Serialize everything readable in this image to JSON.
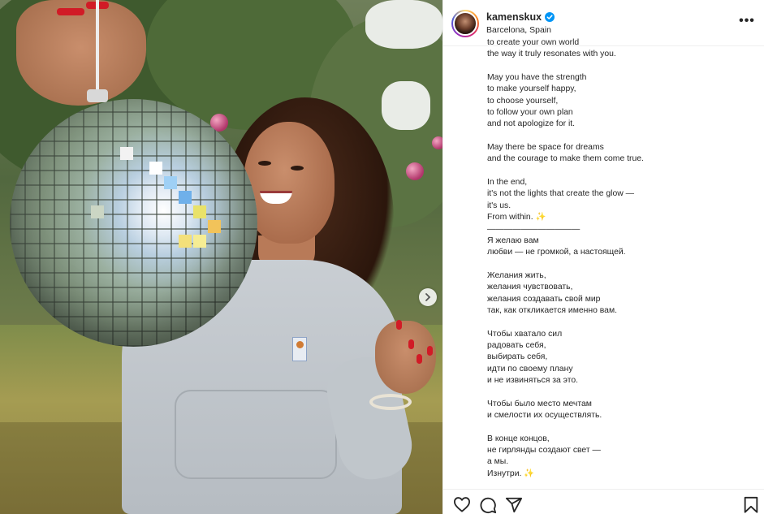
{
  "post": {
    "username": "kamenskux",
    "location": "Barcelona, Spain",
    "more_label": "•••"
  },
  "caption_lines": [
    "to create your own world",
    "the way it truly resonates with you.",
    "",
    "May you have the strength",
    "to make yourself happy,",
    "to choose yourself,",
    "to follow your own plan",
    "and not apologize for it.",
    "",
    "May there be space for dreams",
    "and the courage to make them come true.",
    "",
    "In the end,",
    "it's not the lights that create the glow —",
    "it's us.",
    "From within. ✨",
    "———————————",
    "Я желаю вам",
    "любви — не громкой, а настоящей.",
    "",
    "Желания жить,",
    "желания чувствовать,",
    "желания создавать свой мир",
    "так, как откликается именно вам.",
    "",
    "Чтобы хватало сил",
    "радовать себя,",
    "выбирать себя,",
    "идти по своему плану",
    "и не извиняться за это.",
    "",
    "Чтобы было место мечтам",
    "и смелости их осуществлять.",
    "",
    "В конце концов,",
    "не гирлянды создают свет —",
    "а мы.",
    "Изнутри. ✨"
  ],
  "icons": {
    "verified": "verified-badge-icon",
    "like": "heart-icon",
    "comment": "comment-icon",
    "share": "share-icon",
    "save": "bookmark-icon",
    "next": "chevron-right-icon"
  },
  "colors": {
    "verified": "#0095f6",
    "text": "#262626",
    "nail": "#d11b26"
  }
}
